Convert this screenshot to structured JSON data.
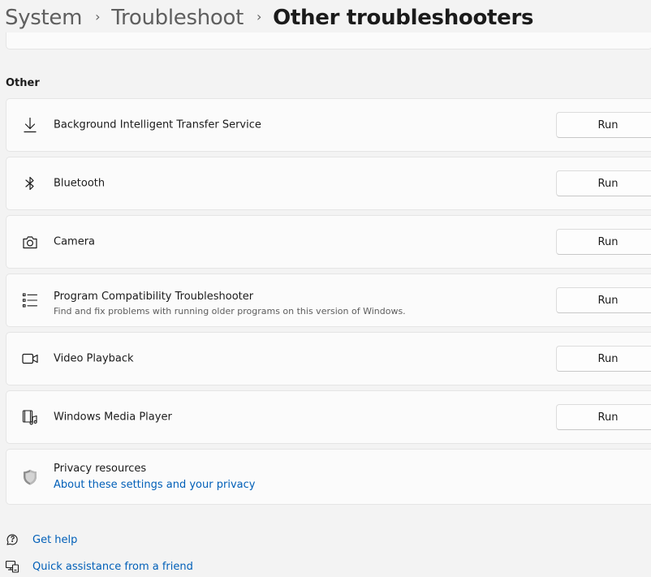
{
  "breadcrumb": {
    "system": "System",
    "troubleshoot": "Troubleshoot",
    "current": "Other troubleshooters",
    "separator": "›"
  },
  "section": {
    "title": "Other"
  },
  "troubleshooters": [
    {
      "title": "Background Intelligent Transfer Service",
      "icon": "download-icon",
      "button": "Run"
    },
    {
      "title": "Bluetooth",
      "icon": "bluetooth-icon",
      "button": "Run"
    },
    {
      "title": "Camera",
      "icon": "camera-icon",
      "button": "Run"
    },
    {
      "title": "Program Compatibility Troubleshooter",
      "description": "Find and fix problems with running older programs on this version of Windows.",
      "icon": "list-icon",
      "button": "Run"
    },
    {
      "title": "Video Playback",
      "icon": "video-icon",
      "button": "Run"
    },
    {
      "title": "Windows Media Player",
      "icon": "media-player-icon",
      "button": "Run"
    }
  ],
  "privacy": {
    "title": "Privacy resources",
    "link": "About these settings and your privacy",
    "icon": "shield-icon"
  },
  "help": {
    "get_help": "Get help",
    "quick_assist": "Quick assistance from a friend"
  },
  "colors": {
    "background": "#f3f3f3",
    "card": "#fbfbfb",
    "link": "#005fb8",
    "text": "#1b1b1b"
  }
}
